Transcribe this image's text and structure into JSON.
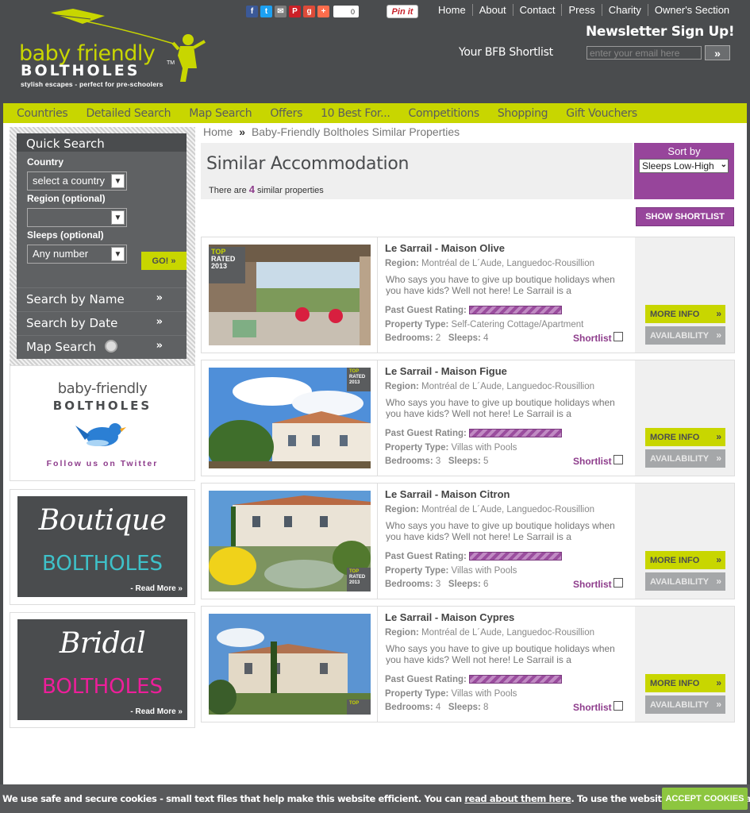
{
  "header": {
    "logo_line1": "baby friendly",
    "logo_line2": "BOLTHOLES",
    "logo_tm": "TM",
    "logo_tagline": "stylish escapes - perfect for pre-schoolers",
    "share_count": "0",
    "pinit_label": "Pin it",
    "top_nav": [
      "Home",
      "About",
      "Contact",
      "Press",
      "Charity",
      "Owner's Section"
    ],
    "newsletter_title": "Newsletter Sign Up!",
    "shortlist_link": "Your BFB Shortlist",
    "email_placeholder": "enter your email here",
    "email_submit": "»"
  },
  "main_nav": [
    "Countries",
    "Detailed Search",
    "Map Search",
    "Offers",
    "10 Best For...",
    "Competitions",
    "Shopping",
    "Gift Vouchers"
  ],
  "sidebar": {
    "quick_search_title": "Quick Search",
    "country_label": "Country",
    "country_value": "select a country",
    "region_label": "Region (optional)",
    "region_value": "",
    "sleeps_label": "Sleeps (optional)",
    "sleeps_value": "Any number",
    "go_label": "GO!  »",
    "links": [
      "Search by Name",
      "Search by Date",
      "Map Search"
    ],
    "link_chevron": "»",
    "twitter_line1": "baby-friendly",
    "twitter_line2": "BOLTHOLES",
    "twitter_line3": "Follow us on Twitter",
    "boutique_script": "Boutique",
    "boutique_name": "BOLTHOLES",
    "bridal_script": "Bridal",
    "bridal_name": "BOLTHOLES",
    "read_more": "- Read More »"
  },
  "breadcrumb": {
    "home": "Home",
    "sep": "»",
    "current": "Baby-Friendly Boltholes Similar Properties"
  },
  "heading": "Similar Accommodation",
  "count": {
    "prefix": "There are ",
    "number": "4",
    "suffix": " similar properties"
  },
  "sort": {
    "label": "Sort by",
    "value": "Sleeps Low-High"
  },
  "show_shortlist": "SHOW SHORTLIST",
  "labels": {
    "region": "Region:",
    "rating": "Past Guest Rating:",
    "type": "Property Type:",
    "bedrooms": "Bedrooms:",
    "sleeps": "Sleeps:",
    "shortlist": "Shortlist",
    "more_info": "MORE INFO",
    "availability": "AVAILABILITY",
    "chevron": "»"
  },
  "properties": [
    {
      "title": "Le Sarrail - Maison Olive",
      "region": "Montréal de L´Aude, Languedoc-Rousillion",
      "desc": "Who says you have to give up boutique holidays when you have kids? Well not here! Le Sarrail is a",
      "type": "Self-Catering Cottage/Apartment",
      "bedrooms": "2",
      "sleeps": "4",
      "rating": 1.0
    },
    {
      "title": "Le Sarrail - Maison Figue",
      "region": "Montréal de L´Aude, Languedoc-Rousillion",
      "desc": "Who says you have to give up boutique holidays when you have kids? Well not here! Le Sarrail is a",
      "type": "Villas with Pools",
      "bedrooms": "3",
      "sleeps": "5",
      "rating": 1.0
    },
    {
      "title": "Le Sarrail - Maison Citron",
      "region": "Montréal de L´Aude, Languedoc-Rousillion",
      "desc": "Who says you have to give up boutique holidays when you have kids? Well not here! Le Sarrail is a",
      "type": "Villas with Pools",
      "bedrooms": "3",
      "sleeps": "6",
      "rating": 1.0
    },
    {
      "title": "Le Sarrail - Maison Cypres",
      "region": "Montréal de L´Aude, Languedoc-Rousillion",
      "desc": "Who says you have to give up boutique holidays when you have kids? Well not here! Le Sarrail is a",
      "type": "Villas with Pools",
      "bedrooms": "4",
      "sleeps": "8",
      "rating": 1.0
    }
  ],
  "top_rated_badge": {
    "line1": "TOP",
    "line2": "RATED",
    "line3": "2013"
  },
  "cookie": {
    "text_before": "We use safe and secure cookies - small text files that help make this website efficient. You can ",
    "link": "read about them here",
    "text_after": ". To use the website as intended please...",
    "accept": "ACCEPT COOKIES"
  },
  "colors": {
    "accent_green": "#c8d600",
    "accent_purple": "#97459b",
    "header_grey": "#4a4c4e"
  }
}
